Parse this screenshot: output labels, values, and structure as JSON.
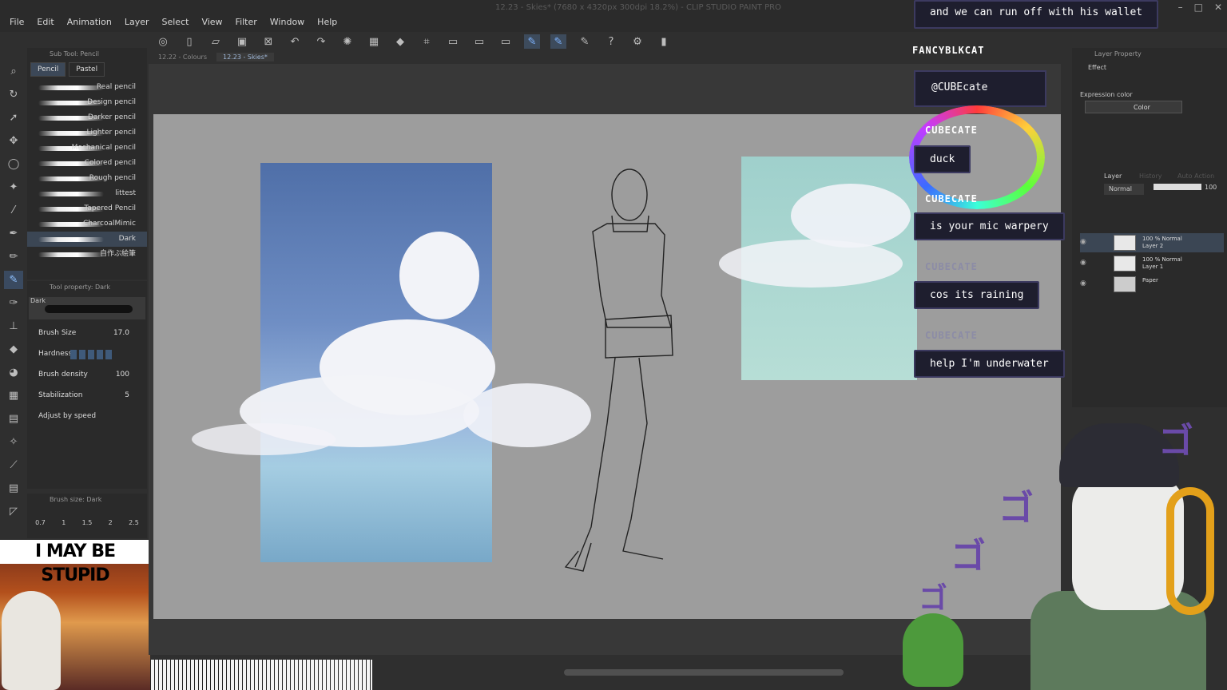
{
  "app": {
    "title": "12.23 - Skies* (7680 x 4320px 300dpi 18.2%) - CLIP STUDIO PAINT PRO",
    "menu": [
      "File",
      "Edit",
      "Animation",
      "Layer",
      "Select",
      "View",
      "Filter",
      "Window",
      "Help"
    ]
  },
  "doc_tabs": [
    {
      "label": "12.22 - Colours",
      "active": false
    },
    {
      "label": "12.23 - Skies*",
      "active": true
    }
  ],
  "subtool": {
    "header": "Sub Tool: Pencil",
    "tabs": [
      "Pencil",
      "Pastel"
    ],
    "brushes": [
      "Real pencil",
      "Design pencil",
      "Darker pencil",
      "Lighter pencil",
      "Mechanical pencil",
      "Colored pencil",
      "Rough pencil",
      "littest",
      "Tapered Pencil",
      "CharcoalMimic",
      "Dark",
      "自作ぶ絵筆"
    ],
    "selected": "Dark"
  },
  "toolprop": {
    "header": "Tool property: Dark",
    "preview_name": "Dark",
    "brush_size_label": "Brush Size",
    "brush_size": "17.0",
    "hardness_label": "Hardness",
    "density_label": "Brush density",
    "density": "100",
    "stabilization_label": "Stabilization",
    "stabilization": "5",
    "adjust_label": "Adjust by speed"
  },
  "brush_size_panel": {
    "header": "Brush size: Dark",
    "values": [
      "0.7",
      "1",
      "1.5",
      "2",
      "2.5"
    ]
  },
  "meme": {
    "caption": "I MAY BE STUPID"
  },
  "chat": {
    "top_message": "and we can run off with his wallet",
    "top_user": "FANCYBLKCAT",
    "mention": "@CUBEcate",
    "messages": [
      {
        "user": "CUBECATE",
        "text": "duck"
      },
      {
        "user": "CUBECATE",
        "text": "is your mic warpery"
      },
      {
        "user": "CUBECATE",
        "text": "cos its raining"
      },
      {
        "user": "CUBECATE",
        "text": "help I'm underwater"
      }
    ]
  },
  "layer_property": {
    "header": "Layer Property",
    "effect_label": "Effect",
    "expression_label": "Expression color",
    "expression_value": "Color"
  },
  "layer_panel": {
    "tabs": [
      "Layer",
      "History",
      "Auto Action"
    ],
    "blend": "Normal",
    "opacity": "100",
    "layers": [
      {
        "line1": "100 % Normal",
        "line2": "Layer 2",
        "selected": true
      },
      {
        "line1": "100 % Normal",
        "line2": "Layer 1",
        "selected": false
      },
      {
        "line1": "",
        "line2": "Paper",
        "selected": false
      }
    ]
  },
  "colors": {
    "accent": "#7fb4ff",
    "chat_border": "#3c3a60",
    "chat_bg": "#1e1e2e"
  }
}
